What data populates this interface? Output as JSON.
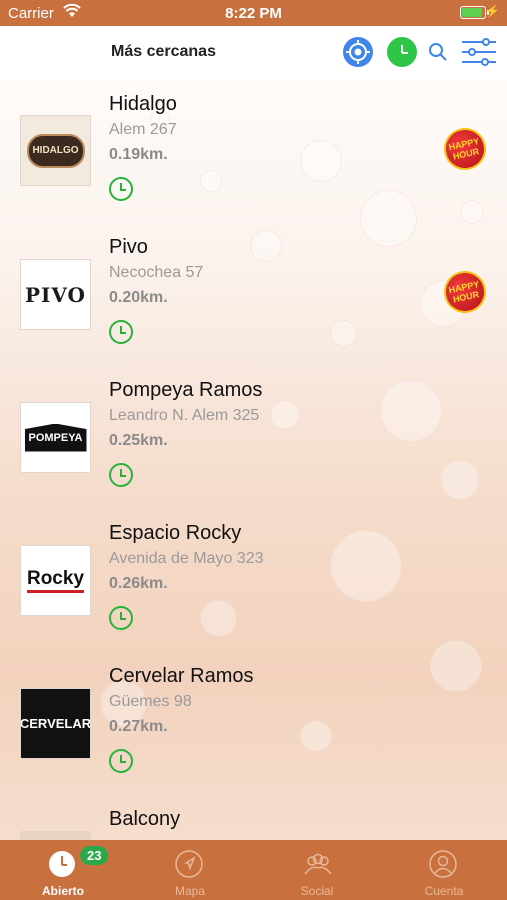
{
  "status": {
    "carrier": "Carrier",
    "time": "8:22 PM",
    "battery_level": 1.0
  },
  "nav": {
    "title": "Más cercanas",
    "icons": [
      "locate-icon",
      "clock-icon",
      "search-icon",
      "filter-icon"
    ],
    "colors": {
      "locate": "#3f86e8",
      "clock": "#2fc549",
      "search": "#3f86e8"
    }
  },
  "places": [
    {
      "name": "Hidalgo",
      "address": "Alem 267",
      "distance": "0.19km.",
      "logo_text": "HIDALGO",
      "happy_hour": true
    },
    {
      "name": "Pivo",
      "address": "Necochea 57",
      "distance": "0.20km.",
      "logo_text": "PIVO",
      "happy_hour": true
    },
    {
      "name": "Pompeya Ramos",
      "address": "Leandro N. Alem 325",
      "distance": "0.25km.",
      "logo_text": "POMPEYA",
      "happy_hour": false
    },
    {
      "name": "Espacio Rocky",
      "address": "Avenida de Mayo 323",
      "distance": "0.26km.",
      "logo_text": "Rocky",
      "happy_hour": false
    },
    {
      "name": "Cervelar Ramos",
      "address": "Güemes 98",
      "distance": "0.27km.",
      "logo_text": "CERVELAR",
      "happy_hour": false
    },
    {
      "name": "Balcony",
      "address": "",
      "distance": "",
      "logo_text": "",
      "happy_hour": false
    }
  ],
  "happy_hour_badge": {
    "line1": "HAPPY",
    "line2": "HOUR"
  },
  "tabs": [
    {
      "label": "Abierto",
      "active": true,
      "badge": "23"
    },
    {
      "label": "Mapa",
      "active": false
    },
    {
      "label": "Social",
      "active": false
    },
    {
      "label": "Cuenta",
      "active": false
    }
  ],
  "colors": {
    "bar": "#c9703f",
    "accent_green": "#27b33a"
  }
}
